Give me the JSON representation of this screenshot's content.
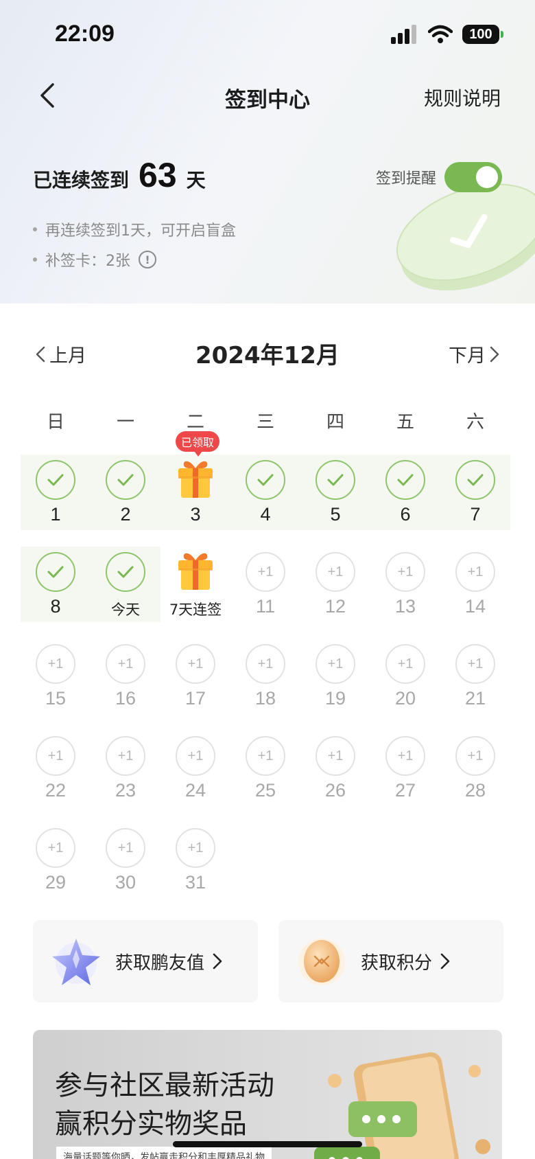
{
  "status_bar": {
    "time": "22:09",
    "battery": "100"
  },
  "nav": {
    "title": "签到中心",
    "rules_label": "规则说明"
  },
  "streak": {
    "prefix": "已连续签到",
    "days": "63",
    "suffix": "天"
  },
  "reminder": {
    "label": "签到提醒",
    "enabled": true
  },
  "tips": {
    "tip1": "再连续签到1天，可开启盲盒",
    "tip2": "补签卡：2张"
  },
  "calendar": {
    "prev_label": "上月",
    "next_label": "下月",
    "month_title": "2024年12月",
    "weekdays": [
      "日",
      "一",
      "二",
      "三",
      "四",
      "五",
      "六"
    ],
    "claimed_badge": "已领取",
    "future_points": "+1",
    "days": [
      {
        "label": "1",
        "state": "done"
      },
      {
        "label": "2",
        "state": "done"
      },
      {
        "label": "3",
        "state": "gift-claimed"
      },
      {
        "label": "4",
        "state": "done"
      },
      {
        "label": "5",
        "state": "done"
      },
      {
        "label": "6",
        "state": "done"
      },
      {
        "label": "7",
        "state": "done"
      },
      {
        "label": "8",
        "state": "done"
      },
      {
        "label": "今天",
        "state": "done"
      },
      {
        "label": "7天连签",
        "state": "gift"
      },
      {
        "label": "11",
        "state": "future"
      },
      {
        "label": "12",
        "state": "future"
      },
      {
        "label": "13",
        "state": "future"
      },
      {
        "label": "14",
        "state": "future"
      },
      {
        "label": "15",
        "state": "future"
      },
      {
        "label": "16",
        "state": "future"
      },
      {
        "label": "17",
        "state": "future"
      },
      {
        "label": "18",
        "state": "future"
      },
      {
        "label": "19",
        "state": "future"
      },
      {
        "label": "20",
        "state": "future"
      },
      {
        "label": "21",
        "state": "future"
      },
      {
        "label": "22",
        "state": "future"
      },
      {
        "label": "23",
        "state": "future"
      },
      {
        "label": "24",
        "state": "future"
      },
      {
        "label": "25",
        "state": "future"
      },
      {
        "label": "26",
        "state": "future"
      },
      {
        "label": "27",
        "state": "future"
      },
      {
        "label": "28",
        "state": "future"
      },
      {
        "label": "29",
        "state": "future"
      },
      {
        "label": "30",
        "state": "future"
      },
      {
        "label": "31",
        "state": "future"
      }
    ]
  },
  "cards": {
    "friend_value": "获取鹏友值",
    "points": "获取积分"
  },
  "banner": {
    "line1": "参与社区最新活动",
    "line2": "赢积分实物奖品",
    "sub": "海量话题等你晒，发帖赢走积分和丰厚精品礼物"
  },
  "colors": {
    "accent_green": "#7ab852",
    "badge_red": "#f04848"
  }
}
